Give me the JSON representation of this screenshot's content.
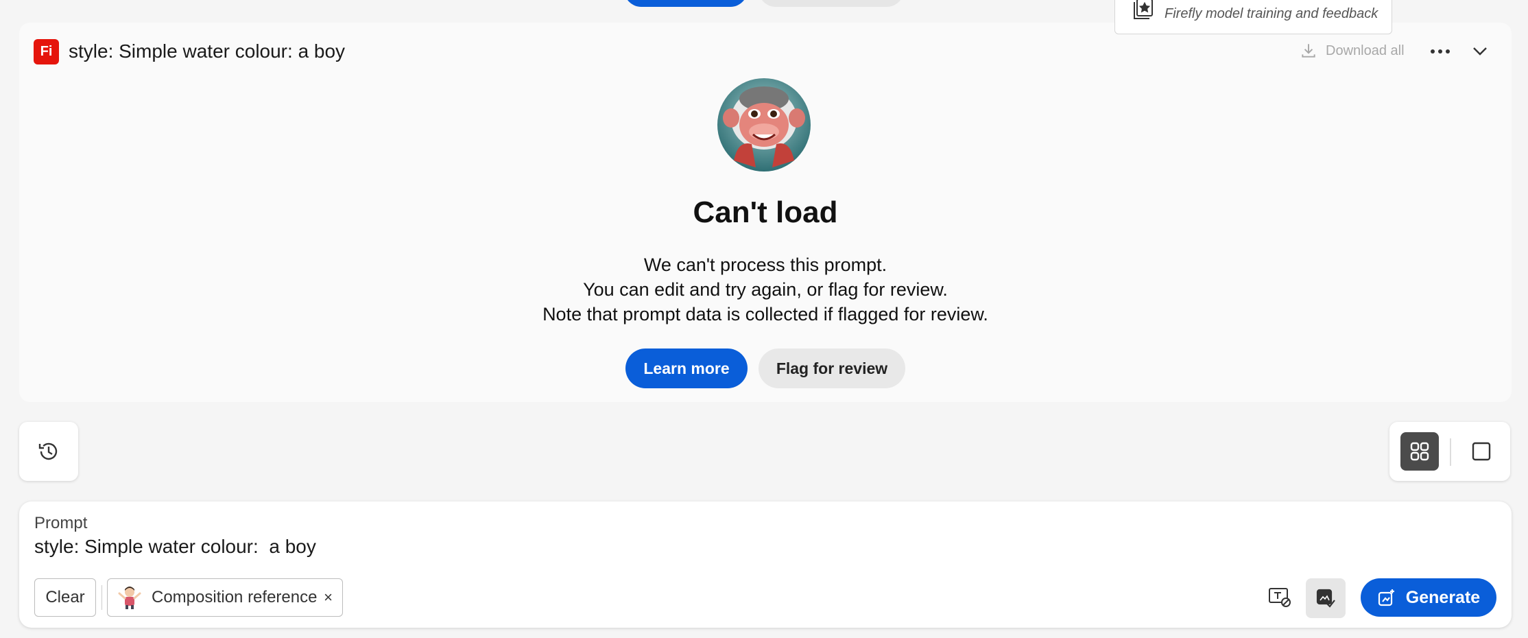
{
  "popup": {
    "text": "Firefly model training and feedback",
    "icon": "star-card-icon"
  },
  "card": {
    "badge": "Fi",
    "title": "style: Simple water colour: a boy",
    "download_all": "Download all",
    "heading": "Can't load",
    "message_lines": [
      "We can't process this prompt.",
      "You can edit and try again, or flag for review.",
      "Note that prompt data is collected if flagged for review."
    ],
    "learn_more": "Learn more",
    "flag_review": "Flag for review"
  },
  "prompt": {
    "label": "Prompt",
    "text": "style: Simple water colour:  a boy",
    "clear": "Clear",
    "composition_chip": "Composition reference",
    "chip_close": "×",
    "generate": "Generate"
  },
  "colors": {
    "accent": "#0a5ed9",
    "badge": "#e5150c",
    "toggle_active": "#4b4b4b"
  }
}
